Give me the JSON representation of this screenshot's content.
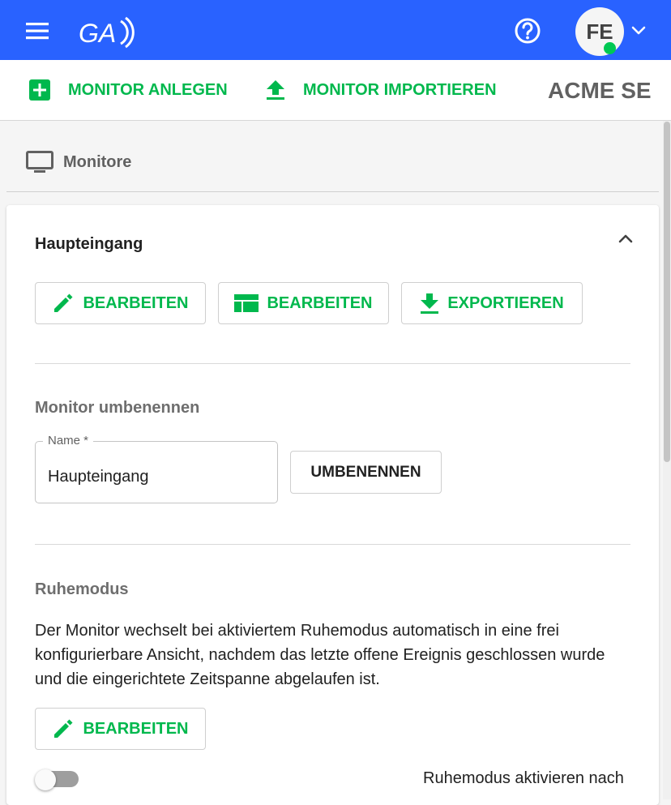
{
  "topbar": {
    "logo_text": "GA",
    "avatar_initials": "FE"
  },
  "actions": {
    "create_label": "MONITOR ANLEGEN",
    "import_label": "MONITOR IMPORTIEREN",
    "company": "ACME SE"
  },
  "section": {
    "title": "Monitore"
  },
  "card": {
    "title": "Haupteingang",
    "buttons": {
      "edit_label": "BEARBEITEN",
      "layout_edit_label": "BEARBEITEN",
      "export_label": "EXPORTIEREN"
    },
    "rename": {
      "title": "Monitor umbenennen",
      "field_label": "Name *",
      "field_value": "Haupteingang",
      "button_label": "UMBENENNEN"
    },
    "sleep": {
      "title": "Ruhemodus",
      "description": "Der Monitor wechselt bei aktiviertem Ruhemodus automatisch in eine frei konfigurierbare Ansicht, nachdem das letzte offene Ereignis geschlossen wurde und die eingerichtete Zeitspanne abgelaufen ist.",
      "edit_label": "BEARBEITEN",
      "toggle_label": "Ruhemodus aktivieren nach"
    }
  },
  "colors": {
    "primary_blue": "#2962ff",
    "accent_green": "#00b84d",
    "online_green": "#00c853"
  },
  "icons": {
    "menu": "menu-icon",
    "help": "help-circle-icon",
    "chevron": "chevron-down-icon",
    "add": "add-box-icon",
    "upload": "upload-icon",
    "monitor": "monitor-icon",
    "collapse": "chevron-up-icon",
    "pencil": "pencil-icon",
    "layout": "layout-icon",
    "download": "download-icon"
  }
}
